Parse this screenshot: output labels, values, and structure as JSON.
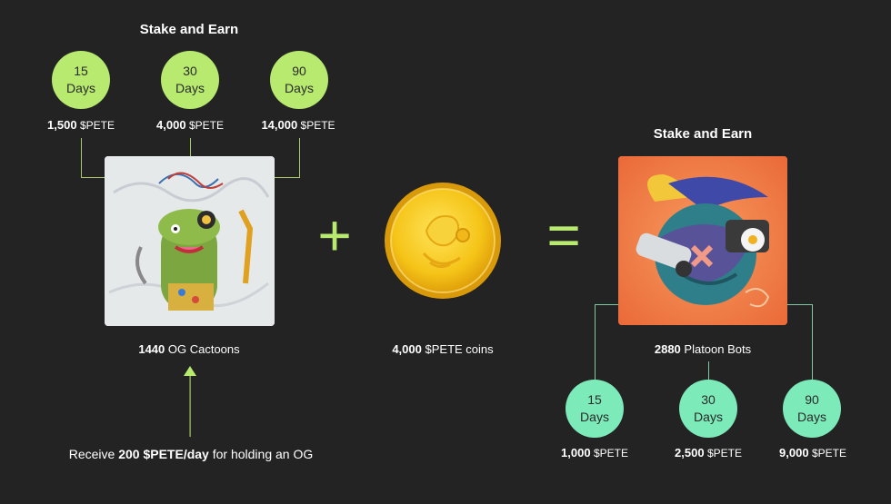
{
  "left": {
    "title": "Stake and Earn",
    "tiers": [
      {
        "days": "15",
        "unit": "Days",
        "amount": "1,500",
        "token": "$PETE"
      },
      {
        "days": "30",
        "unit": "Days",
        "amount": "4,000",
        "token": "$PETE"
      },
      {
        "days": "90",
        "unit": "Days",
        "amount": "14,000",
        "token": "$PETE"
      }
    ],
    "caption_count": "1440",
    "caption_name": "OG Cactoons",
    "receive_prefix": "Receive",
    "receive_amount": "200 $PETE/day",
    "receive_suffix": "for holding an OG",
    "colors": {
      "circle": "#b7ea6e",
      "line": "#a9c76a"
    }
  },
  "middle": {
    "plus": "+",
    "equals": "=",
    "coin_amount": "4,000",
    "coin_label": "$PETE coins"
  },
  "right": {
    "title": "Stake and Earn",
    "tiers": [
      {
        "days": "15",
        "unit": "Days",
        "amount": "1,000",
        "token": "$PETE"
      },
      {
        "days": "30",
        "unit": "Days",
        "amount": "2,500",
        "token": "$PETE"
      },
      {
        "days": "90",
        "unit": "Days",
        "amount": "9,000",
        "token": "$PETE"
      }
    ],
    "caption_count": "2880",
    "caption_name": "Platoon Bots",
    "colors": {
      "circle": "#7deab9",
      "line": "#7fc8a4"
    }
  }
}
